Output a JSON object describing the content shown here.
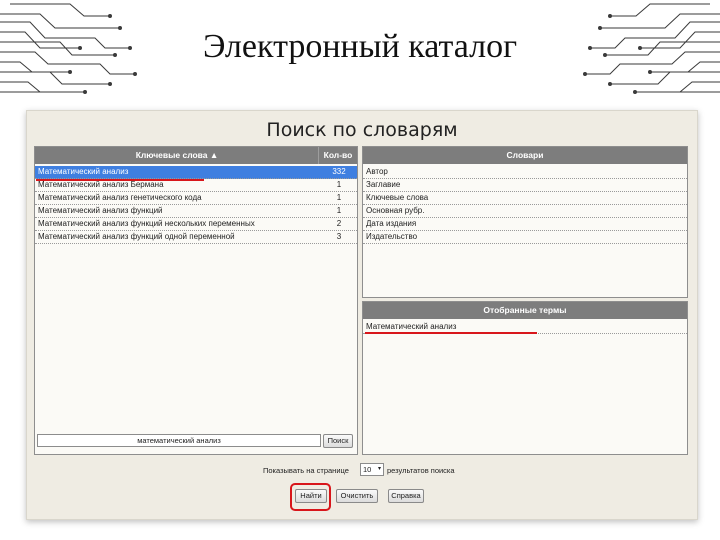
{
  "slide_title": "Электронный каталог",
  "page_title": "Поиск по словарям",
  "keywords_panel": {
    "header_label": "Ключевые слова ▲",
    "header_count": "Кол-во",
    "rows": [
      {
        "label": "Математический анализ",
        "count": "332",
        "selected": true
      },
      {
        "label": "Математический анализ Бермана",
        "count": "1"
      },
      {
        "label": "Математический анализ генетического кода",
        "count": "1"
      },
      {
        "label": "Математический анализ функций",
        "count": "1"
      },
      {
        "label": "Математический анализ функций нескольких переменных",
        "count": "2"
      },
      {
        "label": "Математический анализ функций одной переменной",
        "count": "3"
      }
    ],
    "search_value": "математический анализ",
    "search_button": "Поиск"
  },
  "dictionaries_panel": {
    "header": "Словари",
    "items": [
      "Автор",
      "Заглавие",
      "Ключевые слова",
      "Основная рубр.",
      "Дата издания",
      "Издательство"
    ]
  },
  "selected_terms_panel": {
    "header": "Отобранные термы",
    "items": [
      "Математический анализ"
    ]
  },
  "footer": {
    "show_per_page_label": "Показывать на странице",
    "per_page_value": "10",
    "results_label": "результатов поиска",
    "find_button": "Найти",
    "clear_button": "Очистить",
    "help_button": "Справка"
  },
  "colors": {
    "accent_highlight": "#d8161b",
    "selected_row": "#3f7fe0",
    "panel_header": "#7d7d7d"
  }
}
